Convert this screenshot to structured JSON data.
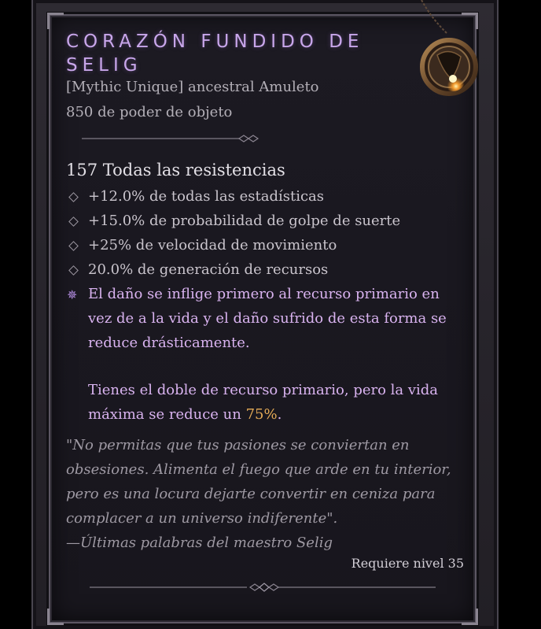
{
  "item": {
    "name": "Corazón fundido de Selig",
    "type_line": "[Mythic Unique] ancestral Amuleto",
    "item_power": "850 de poder de objeto",
    "main_stat": "157 Todas las resistencias",
    "affixes": [
      "+12.0% de todas las estadísticas",
      "+15.0% de probabilidad de golpe de suerte",
      "+25% de velocidad de movimiento",
      "20.0% de generación de recursos"
    ],
    "unique_power": {
      "paragraph1": "El daño se inflige primero al recurso primario en vez de a la vida y el daño sufrido de esta forma se reduce drásticamente.",
      "paragraph2_prefix": "Tienes el doble de recurso primario, pero la vida máxima se reduce un ",
      "paragraph2_value": "75%",
      "paragraph2_suffix": "."
    },
    "flavor_text": "\"No permitas que tus pasiones se conviertan en obsesiones. Alimenta el fuego que arde en tu interior, pero es una locura dejarte convertir en ceniza para complacer a un universo indiferente\".",
    "flavor_attribution": "—Últimas palabras del maestro Selig",
    "required_level": "Requiere nivel 35"
  },
  "icons": {
    "affix_bullet": "diamond-bullet-icon",
    "unique_power_marker": "mythic-spark-icon",
    "item_image": "amulet-icon"
  },
  "colors": {
    "title": "#c8a6ea",
    "unique_power": "#d9b3f0",
    "highlight": "#e5ab57"
  }
}
